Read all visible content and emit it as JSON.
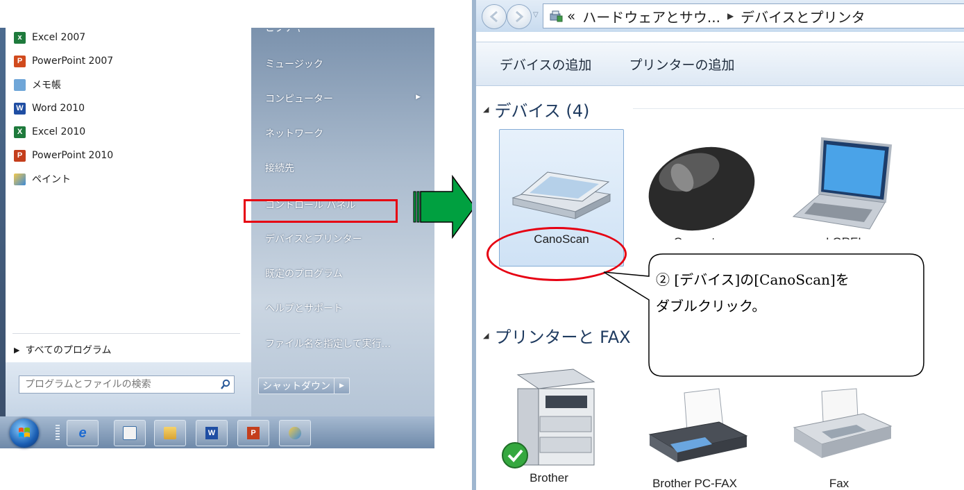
{
  "start_menu": {
    "programs": [
      {
        "label": "Excel 2007",
        "icon": "excel-2007-icon"
      },
      {
        "label": "PowerPoint 2007",
        "icon": "powerpoint-2007-icon"
      },
      {
        "label": "メモ帳",
        "icon": "notepad-icon"
      },
      {
        "label": "Word 2010",
        "icon": "word-2010-icon"
      },
      {
        "label": "Excel 2010",
        "icon": "excel-2010-icon"
      },
      {
        "label": "PowerPoint 2010",
        "icon": "powerpoint-2010-icon"
      },
      {
        "label": "ペイント",
        "icon": "paint-icon"
      }
    ],
    "all_programs": "すべてのプログラム",
    "search_placeholder": "プログラムとファイルの検索",
    "right_top_partial": "ピクチャ",
    "right_items": [
      "ミュージック",
      "コンピューター",
      "ネットワーク",
      "接続先",
      "コントロール パネル",
      "デバイスとプリンター",
      "既定のプログラム",
      "ヘルプとサポート",
      "ファイル名を指定して実行..."
    ],
    "shutdown_label": "シャットダウン",
    "highlighted_item": "デバイスとプリンター"
  },
  "taskbar": {
    "items": [
      "ie-icon",
      "outlook-icon",
      "explorer-icon",
      "word-icon",
      "powerpoint-icon",
      "paint-icon"
    ]
  },
  "explorer": {
    "address": {
      "back_chevrons": "«",
      "crumb1": "ハードウェアとサウ...",
      "crumb2": "デバイスとプリンタ"
    },
    "commands": [
      "デバイスの追加",
      "プリンターの追加"
    ],
    "groups": {
      "devices": "デバイス (4)",
      "printers": "プリンターと FAX"
    },
    "devices": [
      "CanoScan",
      "Computer",
      "LOREL"
    ],
    "printers": [
      "Brother",
      "Brother PC-FAX",
      "Fax"
    ]
  },
  "callout": {
    "line1": "② [デバイス]の[CanoScan]を",
    "line2": "ダブルクリック。"
  },
  "colors": {
    "highlight_red": "#e60012",
    "arrow_green": "#00a040",
    "start_right_panel": "#8ea4bf"
  }
}
